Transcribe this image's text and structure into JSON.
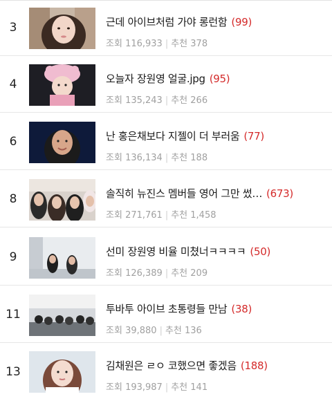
{
  "rows": [
    {
      "rank": "3",
      "title": "근데 아이브처럼 가야 롱런함",
      "comments": "(99)",
      "views_label": "조회",
      "views": "116,933",
      "recommend_label": "추천",
      "recommend": "378"
    },
    {
      "rank": "4",
      "title": "오늘자 장원영 얼굴.jpg",
      "comments": "(95)",
      "views_label": "조회",
      "views": "135,243",
      "recommend_label": "추천",
      "recommend": "266"
    },
    {
      "rank": "6",
      "title": "난 홍은채보다 지젤이 더 부러움",
      "comments": "(77)",
      "views_label": "조회",
      "views": "136,134",
      "recommend_label": "추천",
      "recommend": "188"
    },
    {
      "rank": "8",
      "title": "솔직히 뉴진스 멤버들 영어 그만 썼…",
      "comments": "(673)",
      "views_label": "조회",
      "views": "271,761",
      "recommend_label": "추천",
      "recommend": "1,458"
    },
    {
      "rank": "9",
      "title": "선미 장원영 비율 미쳤너ㅋㅋㅋㅋ",
      "comments": "(50)",
      "views_label": "조회",
      "views": "126,389",
      "recommend_label": "추천",
      "recommend": "209"
    },
    {
      "rank": "11",
      "title": "투바투 아이브 초통령들 만남",
      "comments": "(38)",
      "views_label": "조회",
      "views": "39,880",
      "recommend_label": "추천",
      "recommend": "136"
    },
    {
      "rank": "13",
      "title": "김채원은 ㄹㅇ 코했으면 좋겠음",
      "comments": "(188)",
      "views_label": "조회",
      "views": "193,987",
      "recommend_label": "추천",
      "recommend": "141"
    }
  ],
  "colors": {
    "comment_count": "#d42a2a",
    "meta_text": "#a0a0a0",
    "title_text": "#1a1a1a"
  }
}
